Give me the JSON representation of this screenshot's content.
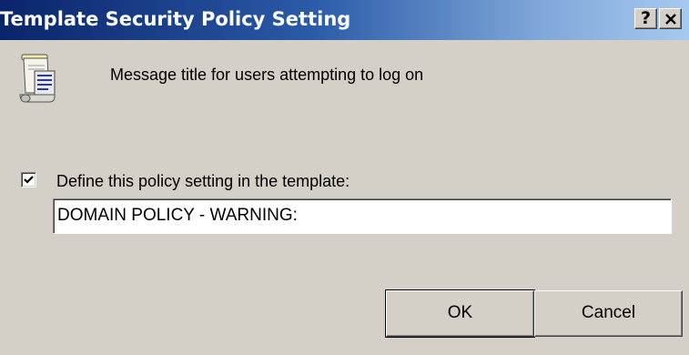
{
  "window": {
    "title": "Template Security Policy Setting",
    "help_button": "?",
    "close_button": "✕"
  },
  "description": "Message title for users attempting to log on",
  "policy": {
    "checkbox_label": "Define this policy setting in the template:",
    "checked": true,
    "value": "DOMAIN POLICY - WARNING:"
  },
  "buttons": {
    "ok": "OK",
    "cancel": "Cancel"
  },
  "icons": {
    "policy": "policy-scroll-icon",
    "check": "checkmark-icon"
  },
  "colors": {
    "titlebar_start": "#0a246a",
    "titlebar_end": "#a6caf0",
    "face": "#d4d0c8"
  }
}
